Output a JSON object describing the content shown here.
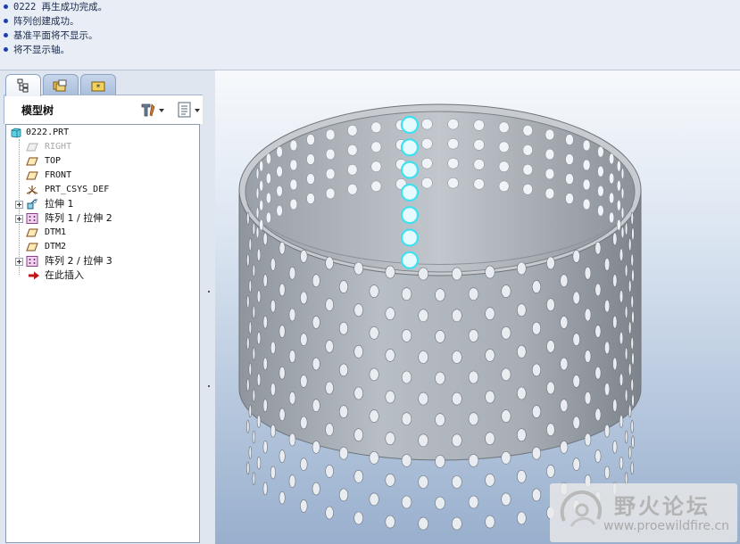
{
  "messages": [
    "0222 再生成功完成。",
    "阵列创建成功。",
    "基准平面将不显示。",
    "将不显示轴。"
  ],
  "nav_tabs": [
    {
      "name": "model-tree-tab",
      "icon": "model-tree-icon"
    },
    {
      "name": "folder-browser-tab",
      "icon": "folder-icon"
    },
    {
      "name": "favorites-tab",
      "icon": "favorites-icon"
    }
  ],
  "model_tree": {
    "title": "模型树",
    "items": [
      {
        "label": "0222.PRT",
        "icon": "part-icon",
        "expandable": false
      },
      {
        "label": "RIGHT",
        "icon": "datum-plane-icon",
        "expandable": false,
        "hidden": true
      },
      {
        "label": "TOP",
        "icon": "datum-plane-icon",
        "expandable": false
      },
      {
        "label": "FRONT",
        "icon": "datum-plane-icon",
        "expandable": false
      },
      {
        "label": "PRT_CSYS_DEF",
        "icon": "csys-icon",
        "expandable": false
      },
      {
        "label": "拉伸 1",
        "icon": "extrude-icon",
        "expandable": true
      },
      {
        "label": "阵列 1 / 拉伸 2",
        "icon": "pattern-icon",
        "expandable": true
      },
      {
        "label": "DTM1",
        "icon": "datum-plane-icon",
        "expandable": false
      },
      {
        "label": "DTM2",
        "icon": "datum-plane-icon",
        "expandable": false
      },
      {
        "label": "阵列 2 / 拉伸 3",
        "icon": "pattern-icon",
        "expandable": true
      },
      {
        "label": "在此插入",
        "icon": "insert-arrow-icon",
        "expandable": false
      }
    ]
  },
  "colors": {
    "accent_blue": "#1f3fb0",
    "model_gray": "#9da3ab",
    "highlight_cyan": "#3fe0f0",
    "insert_red": "#c0161a"
  },
  "watermark": {
    "name": "野火论坛",
    "url": "www.proewildfire.cn"
  }
}
